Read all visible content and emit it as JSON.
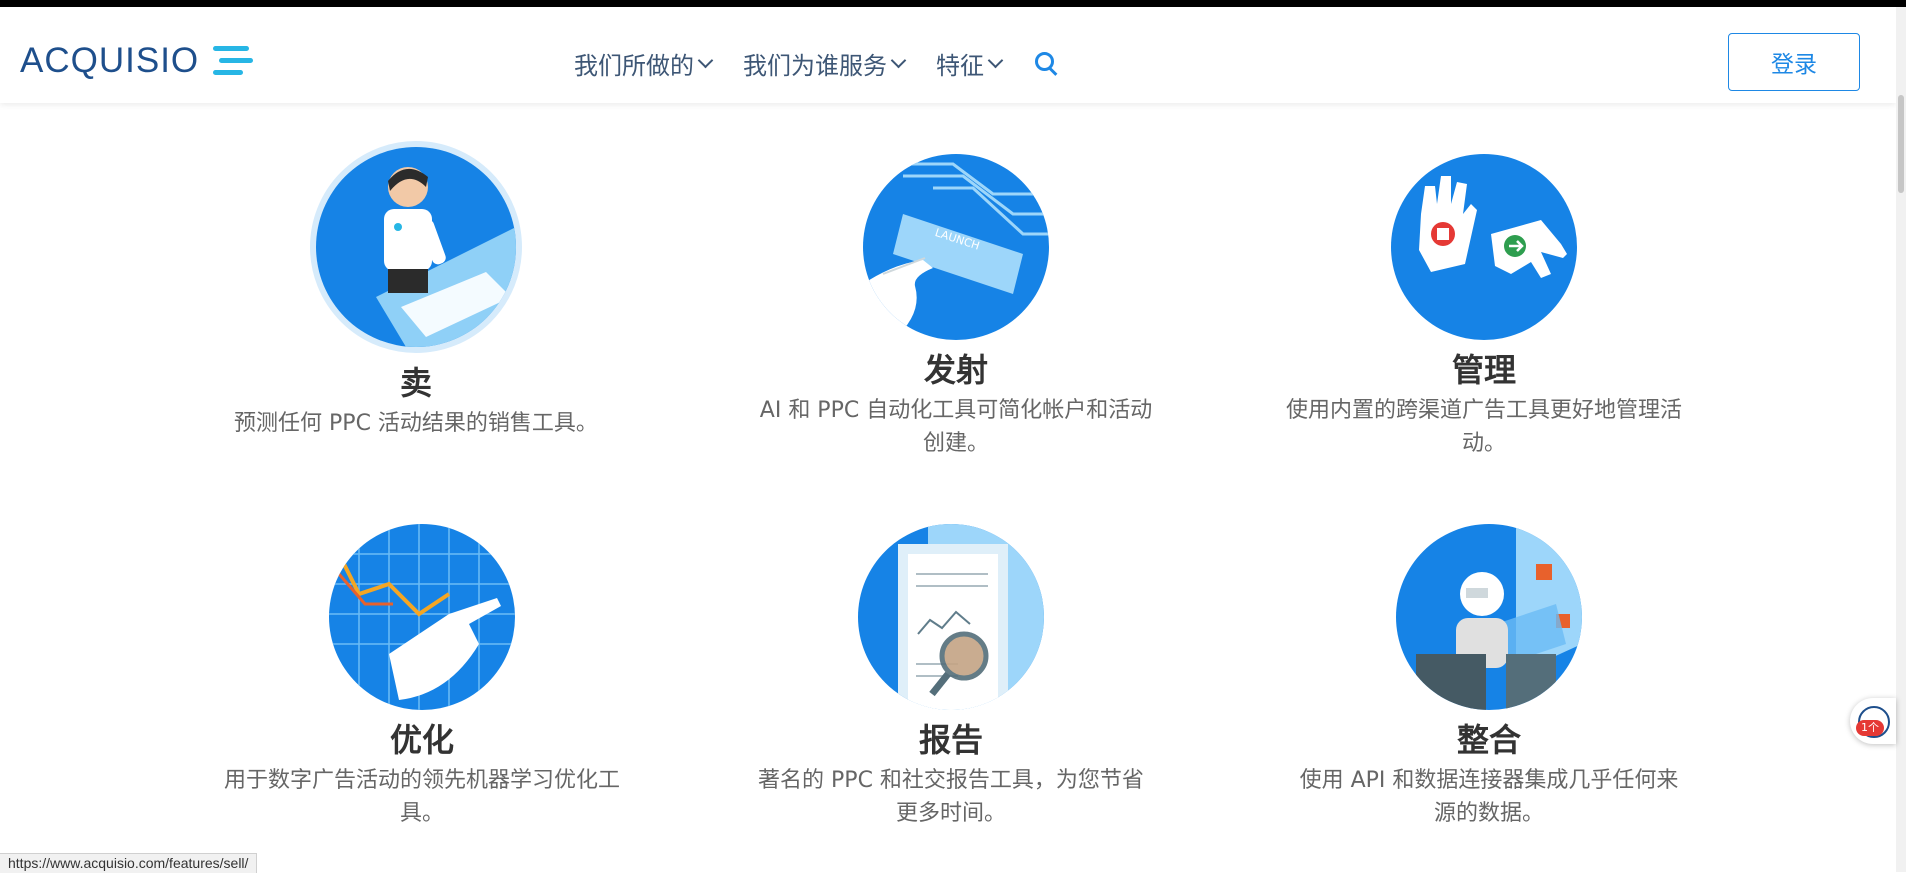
{
  "header": {
    "logo_text": "ACQUISIO",
    "nav": [
      {
        "label": "我们所做的"
      },
      {
        "label": "我们为谁服务"
      },
      {
        "label": "特征"
      }
    ],
    "login_label": "登录"
  },
  "features": [
    {
      "title": "卖",
      "desc": "预测任何 PPC 活动结果的销售工具。",
      "icon": "salesperson-illustration-icon"
    },
    {
      "title": "发射",
      "desc": "AI 和 PPC 自动化工具可简化帐户和活动创建。",
      "icon": "launch-button-illustration-icon"
    },
    {
      "title": "管理",
      "desc": "使用内置的跨渠道广告工具更好地管理活动。",
      "icon": "stop-go-hands-illustration-icon"
    },
    {
      "title": "优化",
      "desc": "用于数字广告活动的领先机器学习优化工具。",
      "icon": "chart-pointing-hand-illustration-icon"
    },
    {
      "title": "报告",
      "desc": "著名的 PPC 和社交报告工具，为您节省更多时间。",
      "icon": "report-magnifier-illustration-icon"
    },
    {
      "title": "整合",
      "desc": "使用 API 和数据连接器集成几乎任何来源的数据。",
      "icon": "robot-integration-illustration-icon"
    }
  ],
  "statusbar": {
    "url": "https://www.acquisio.com/features/sell/"
  },
  "widget": {
    "badge": "1个"
  },
  "colors": {
    "brand": "#1e4f8c",
    "accent": "#1e88e5",
    "logo_lines": "#27b6e5",
    "circle_blue": "#1683e6"
  }
}
